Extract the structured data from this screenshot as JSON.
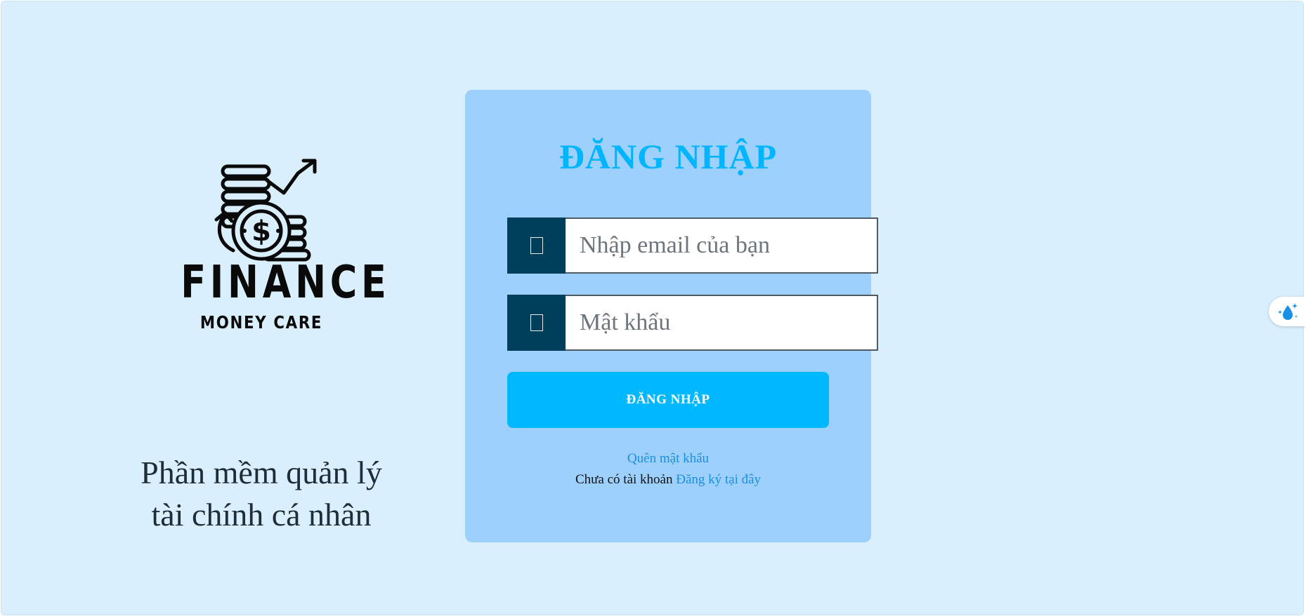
{
  "brand": {
    "name": "FINANCE",
    "subtitle": "MONEY CARE",
    "tagline_line1": "Phần mềm quản lý",
    "tagline_line2": "tài chính cá nhân"
  },
  "login": {
    "title": "ĐĂNG NHẬP",
    "email_placeholder": "Nhập email của bạn",
    "email_value": "",
    "password_placeholder": "Mật khẩu",
    "password_value": "",
    "submit_label": "ĐĂNG NHẬP",
    "forgot_password": "Quên mật khẩu",
    "no_account_text": "Chưa có tài khoản",
    "register_link": "Đăng ký tại đây"
  },
  "icons": {
    "email_field_icon": "missing-glyph-icon",
    "password_field_icon": "missing-glyph-icon",
    "logo": "coins-dollar-chart-icon",
    "floating_widget": "water-drop-sparkle-icon"
  },
  "colors": {
    "background": "#d9effd",
    "card": "#9dd0fd",
    "title": "#00b5ff",
    "button": "#00b8ff",
    "icon_box": "#003f5c",
    "link": "#1a8fe6"
  }
}
